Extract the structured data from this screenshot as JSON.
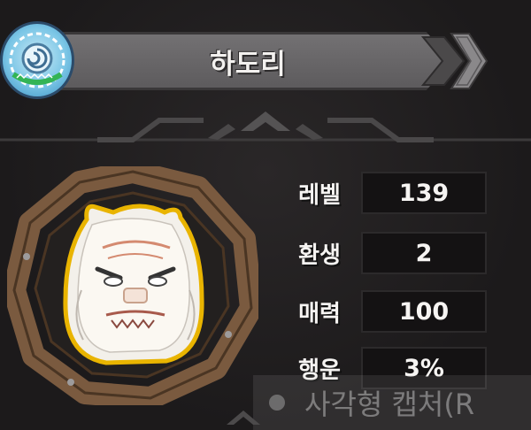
{
  "character": {
    "name": "하도리"
  },
  "stats": [
    {
      "label": "레벨",
      "value": "139"
    },
    {
      "label": "환생",
      "value": "2"
    },
    {
      "label": "매력",
      "value": "100"
    },
    {
      "label": "행운",
      "value": "3%"
    }
  ],
  "overlay": {
    "capture_text": "사각형 캡처(R"
  },
  "icons": {
    "element_badge": "water-element-icon",
    "header_arrows": "double-chevron-right-icon",
    "portrait": "furry-yeti-character-portrait"
  },
  "colors": {
    "banner": "#6a686a",
    "frame_wood": "#7a5a3f",
    "portrait_outline": "#e9b400",
    "badge_blue": "#7bc6e6"
  }
}
